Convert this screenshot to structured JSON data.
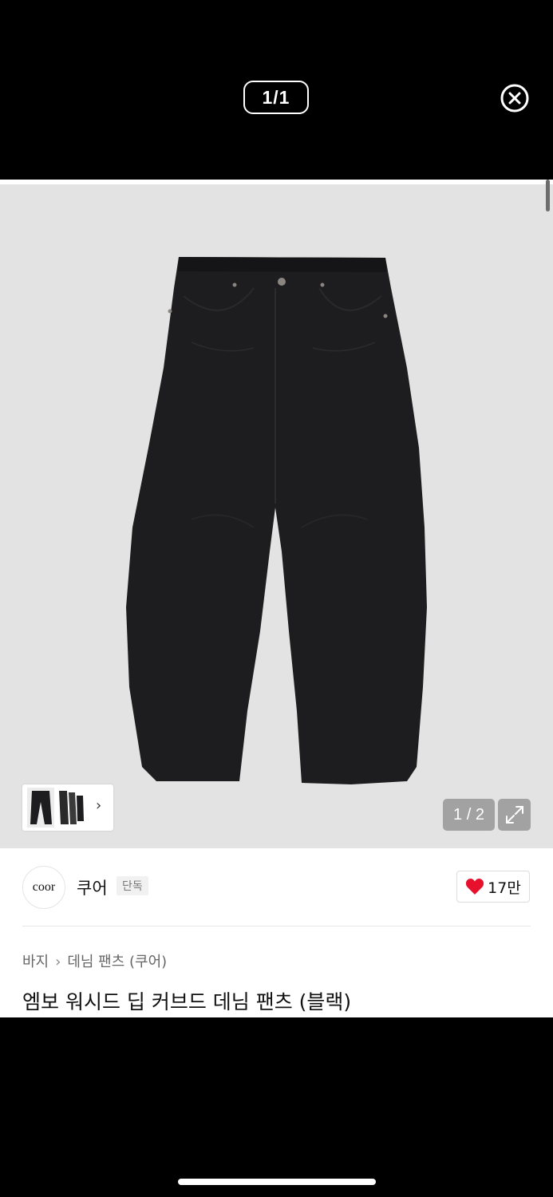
{
  "viewer": {
    "counter": "1/1",
    "close_icon": "close-circle-icon"
  },
  "gallery": {
    "counter": "1 / 2",
    "thumb_arrow": "›",
    "expand_icon": "expand-icon",
    "image_subject": "black curved denim pants"
  },
  "brand": {
    "logo_text": "coor",
    "name": "쿠어",
    "badge": "단독",
    "likes": "17만",
    "like_icon": "heart-icon",
    "like_color": "#e8112d"
  },
  "breadcrumb": {
    "items": [
      "바지",
      "데님 팬츠 (쿠어)"
    ],
    "separator": "›"
  },
  "product": {
    "title": "엠보 워시드 딥 커브드 데님 팬츠 (블랙)"
  }
}
